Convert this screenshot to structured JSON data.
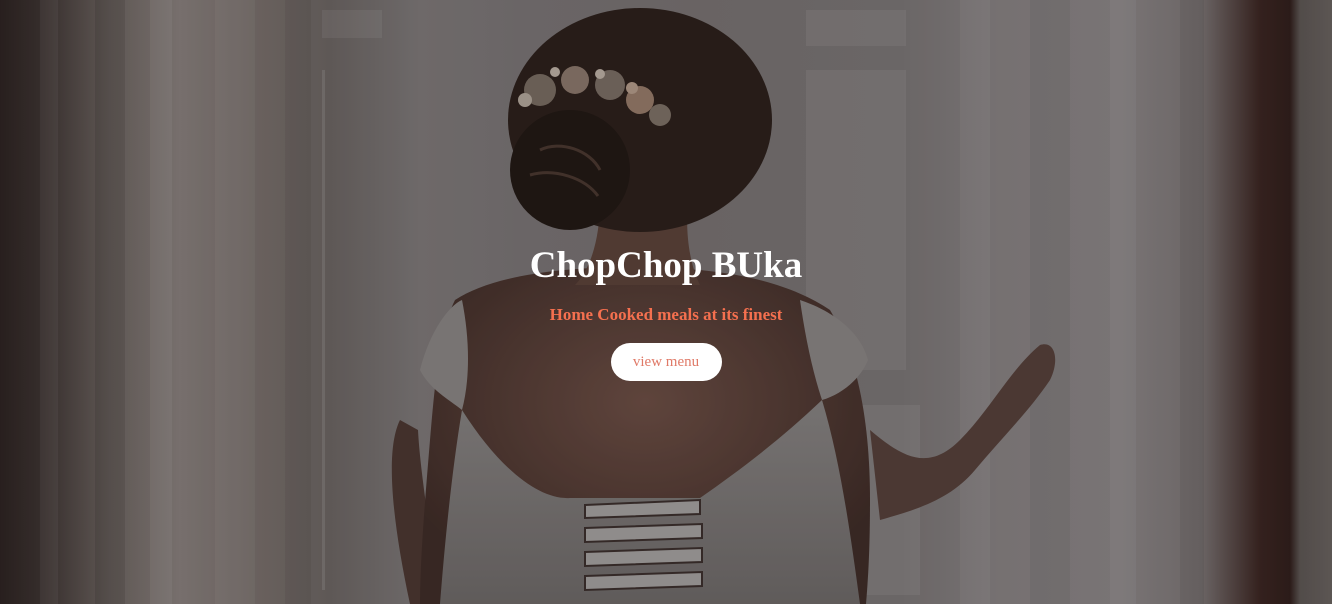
{
  "hero": {
    "title": "ChopChop BUka",
    "tagline": "Home Cooked meals at its finest",
    "button_label": "view menu"
  },
  "colors": {
    "title": "#ffffff",
    "tagline": "#f5704f",
    "button_bg": "#ffffff",
    "button_text": "#e07a68"
  },
  "background": {
    "subject": "bride in lace wedding dress facing window with sheer curtains"
  }
}
